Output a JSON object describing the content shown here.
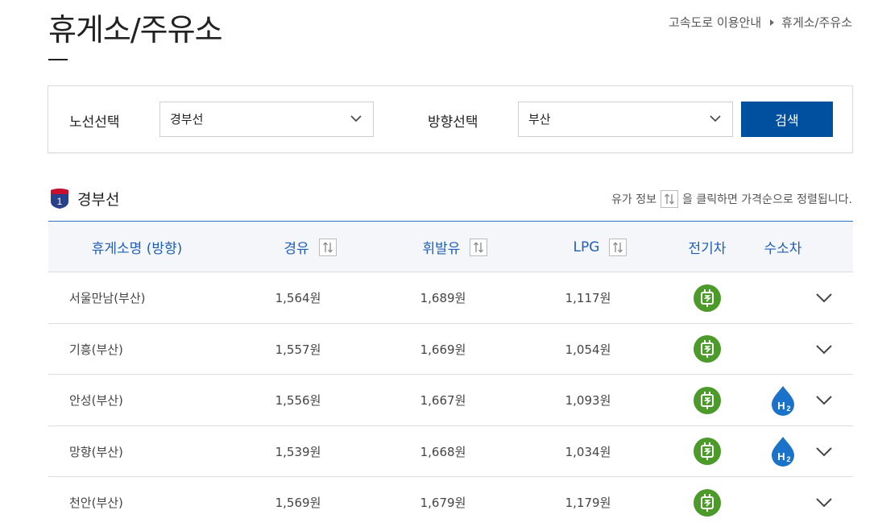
{
  "page": {
    "title": "휴게소/주유소"
  },
  "breadcrumb": {
    "parent": "고속도로 이용안내",
    "current": "휴게소/주유소"
  },
  "filters": {
    "route_label": "노선선택",
    "route_value": "경부선",
    "direction_label": "방향선택",
    "direction_value": "부산",
    "search_label": "검색"
  },
  "route": {
    "badge_number": "1",
    "name": "경부선"
  },
  "sort_hint": {
    "before": "유가 정보",
    "after": "을 클릭하면 가격순으로 정렬됩니다."
  },
  "table": {
    "headers": {
      "name": "휴게소명 (방향)",
      "gasoline": "경유",
      "diesel": "휘발유",
      "lpg": "LPG",
      "ev": "전기차",
      "hydrogen": "수소차"
    },
    "rows": [
      {
        "name": "서울만남(부산)",
        "gasoline": "1,564원",
        "diesel": "1,689원",
        "lpg": "1,117원",
        "ev": true,
        "hydrogen": false
      },
      {
        "name": "기흥(부산)",
        "gasoline": "1,557원",
        "diesel": "1,669원",
        "lpg": "1,054원",
        "ev": true,
        "hydrogen": false
      },
      {
        "name": "안성(부산)",
        "gasoline": "1,556원",
        "diesel": "1,667원",
        "lpg": "1,093원",
        "ev": true,
        "hydrogen": true
      },
      {
        "name": "망향(부산)",
        "gasoline": "1,539원",
        "diesel": "1,668원",
        "lpg": "1,034원",
        "ev": true,
        "hydrogen": true
      },
      {
        "name": "천안(부산)",
        "gasoline": "1,569원",
        "diesel": "1,679원",
        "lpg": "1,179원",
        "ev": true,
        "hydrogen": false
      }
    ]
  },
  "icons": {
    "ev": "ev-charger-icon",
    "hydrogen": "h2-icon",
    "expand": "chevron-down-icon",
    "sort": "sort-arrows-icon",
    "route_shield": "route-shield-icon"
  },
  "colors": {
    "primary": "#0050a0",
    "header_text": "#1f5fb8",
    "ev_green": "#4c9a2a",
    "h2_blue": "#1a73c9",
    "shield_blue": "#27408b",
    "shield_red": "#c8102e"
  }
}
